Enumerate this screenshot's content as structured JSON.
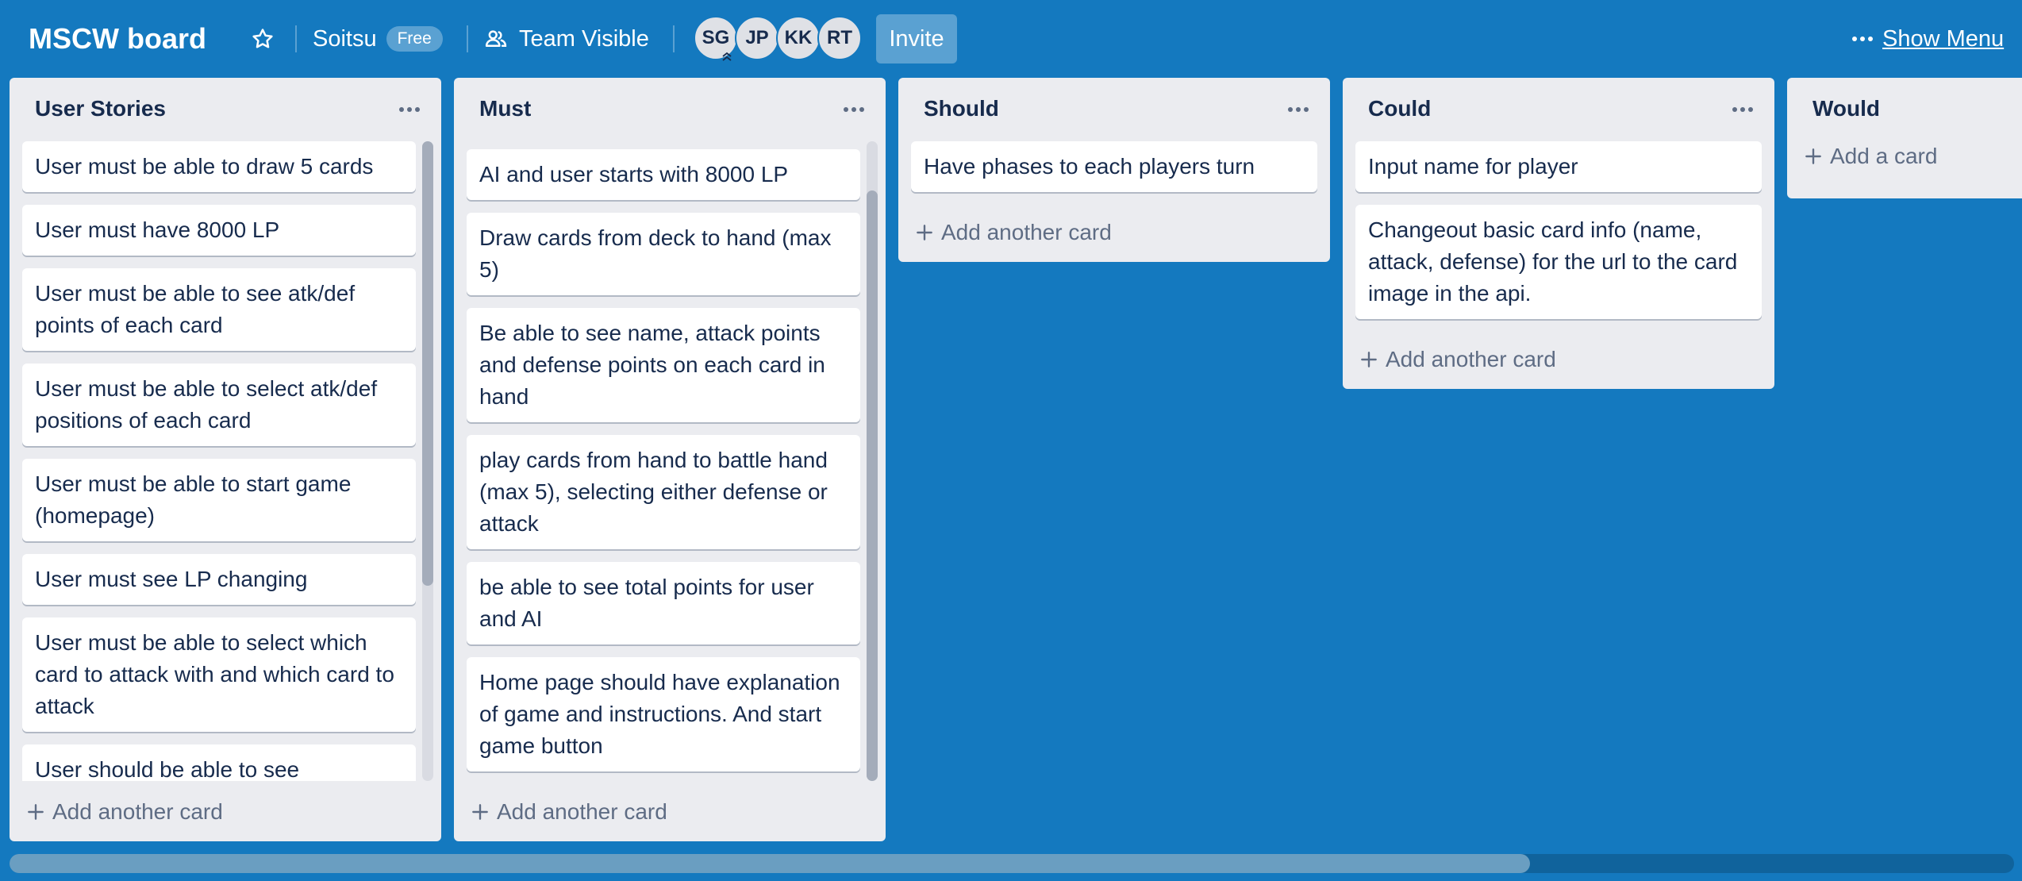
{
  "board": {
    "title": "MSCW board",
    "workspace": "Soitsu",
    "plan_badge": "Free",
    "visibility": "Team Visible",
    "invite_label": "Invite",
    "show_menu_label": "Show Menu",
    "background_color": "#1479bf"
  },
  "members": [
    {
      "initials": "SG",
      "admin": true
    },
    {
      "initials": "JP"
    },
    {
      "initials": "KK"
    },
    {
      "initials": "RT"
    }
  ],
  "lists": [
    {
      "title": "User Stories",
      "add_label": "Add another card",
      "cards": [
        "User must be able to draw 5 cards",
        "User must have 8000 LP",
        "User must be able to see atk/def points of each card",
        "User must be able to select atk/def positions of each card",
        "User must be able to start game (homepage)",
        "User must see LP changing",
        "User must be able to select which card to attack with and which card to attack",
        "User should be able to see"
      ]
    },
    {
      "title": "Must",
      "add_label": "Add another card",
      "cards": [
        "AI and user starts with 8000 LP",
        "Draw cards from deck to hand (max 5)",
        "Be able to see name, attack points and defense points on each card in hand",
        "play cards from hand to battle hand (max 5), selecting either defense or attack",
        "be able to see total points for user and AI",
        "Home page should have explanation of game and instructions. And start game button"
      ]
    },
    {
      "title": "Should",
      "add_label": "Add another card",
      "cards": [
        "Have phases to each players turn"
      ]
    },
    {
      "title": "Could",
      "add_label": "Add another card",
      "cards": [
        "Input name for player",
        "Changeout basic card info (name, attack, defense) for the url to the card image in the api."
      ]
    },
    {
      "title": "Would",
      "add_label": "Add a card",
      "cards": []
    }
  ]
}
